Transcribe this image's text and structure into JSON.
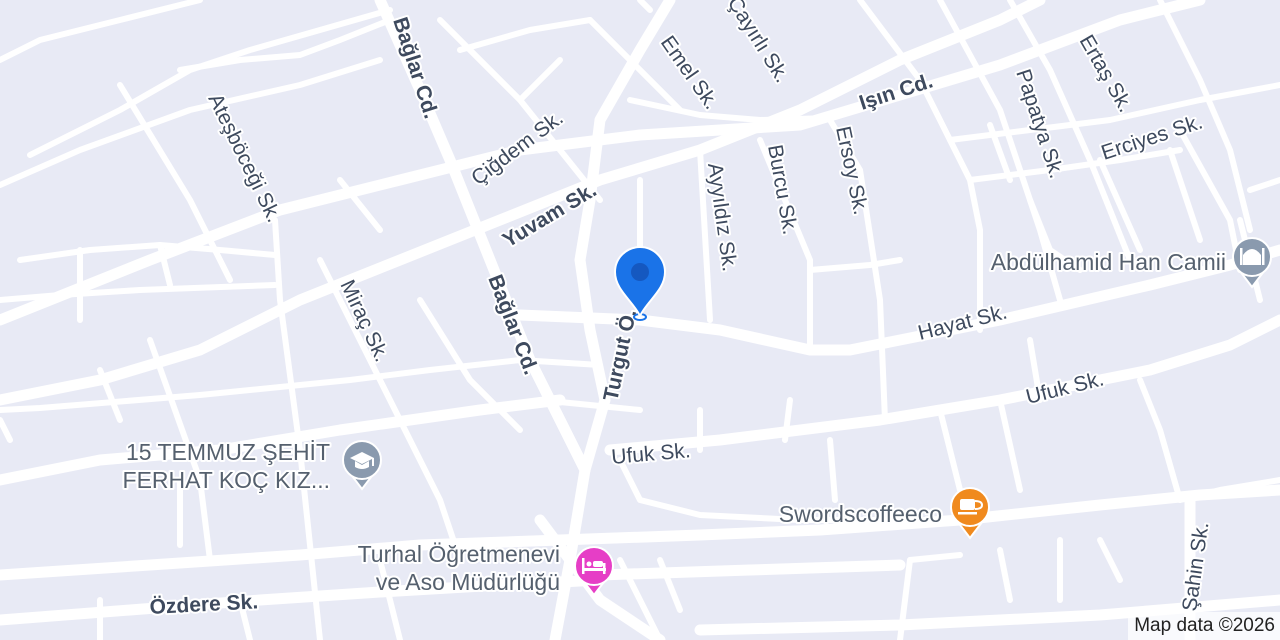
{
  "map": {
    "streets": {
      "baglar_cd_1": "Bağlar Cd.",
      "baglar_cd_2": "Bağlar Cd.",
      "atesbocegi_sk": "Ateşböceği Sk.",
      "cigdem_sk": "Çiğdem Sk.",
      "emel_sk": "Emel Sk.",
      "cayirli_sk": "Çayırlı Sk.",
      "isin_cd": "Işın Cd.",
      "papatya_sk": "Papatya Sk.",
      "ertas_sk": "Ertaş Sk.",
      "erciyes_sk": "Erciyes Sk.",
      "yuvam_sk": "Yuvam Sk.",
      "ayyildiz_sk": "Ayyıldız Sk.",
      "burcu_sk": "Burcu Sk.",
      "ersoy_sk": "Ersoy Sk.",
      "mirac_sk": "Miraç Sk.",
      "turgut_cd": "Turgut Ö.",
      "hayat_sk": "Hayat Sk.",
      "ufuk_sk_1": "Ufuk Sk.",
      "ufuk_sk_2": "Ufuk Sk.",
      "ozdere_sk": "Özdere Sk.",
      "sahin_sk": "Şahin Sk."
    },
    "pois": [
      {
        "lines": [
          "Abdülhamid Han Camii"
        ],
        "icon": "mosque-icon",
        "color": "#8a9aae"
      },
      {
        "lines": [
          "15 TEMMUZ ŞEHİT",
          "FERHAT KOÇ KIZ..."
        ],
        "icon": "school-icon",
        "color": "#8a9aae"
      },
      {
        "lines": [
          "Swordscoffeeco"
        ],
        "icon": "cafe-icon",
        "color": "#f08a1e"
      },
      {
        "lines": [
          "Turhal Öğretmenevi",
          "ve Aso Müdürlüğü"
        ],
        "icon": "hotel-icon",
        "color": "#e63ec6"
      }
    ],
    "marker": {
      "icon": "location-pin-icon",
      "color": "#1a73e8"
    },
    "colors": {
      "land": "#e8eaf5",
      "road": "#ffffff",
      "label": "#3e4a5e"
    },
    "attribution": "Map data ©2026"
  }
}
